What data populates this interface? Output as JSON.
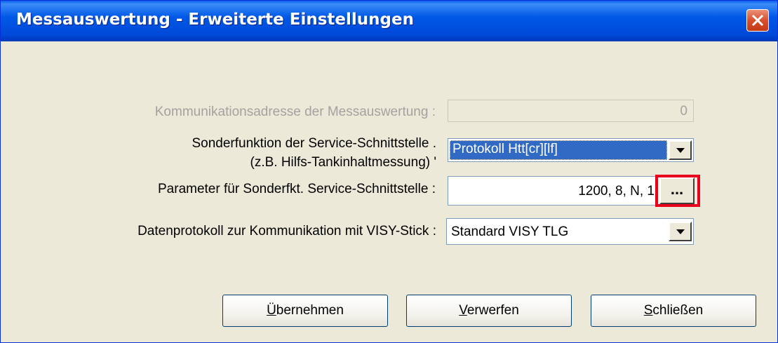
{
  "window": {
    "title": "Messauswertung - Erweiterte Einstellungen",
    "close_icon": "close-x-icon"
  },
  "form": {
    "comm_address": {
      "label": "Kommunikationsadresse der Messauswertung :",
      "value": "0",
      "enabled": false
    },
    "special_function": {
      "label_line1": "Sonderfunktion der Service-Schnittstelle .",
      "label_line2": "(z.B. Hilfs-Tankinhaltmessung) '",
      "value": "Protokoll Htt[cr][lf]"
    },
    "params": {
      "label": "Parameter für Sonderfkt. Service-Schnittstelle :",
      "value": "1200, 8, N, 1",
      "ellipsis": "..."
    },
    "data_protocol": {
      "label": "Datenprotokoll zur Kommunikation mit VISY-Stick :",
      "value": "Standard VISY TLG"
    }
  },
  "buttons": {
    "apply": {
      "pre": "",
      "accel": "Ü",
      "post": "bernehmen"
    },
    "discard": {
      "pre": "",
      "accel": "V",
      "post": "erwerfen"
    },
    "close": {
      "pre": "",
      "accel": "S",
      "post": "chließen"
    }
  },
  "colors": {
    "highlight": "#E8001C",
    "selection": "#316AC5",
    "titlebar": "#0058E6"
  }
}
